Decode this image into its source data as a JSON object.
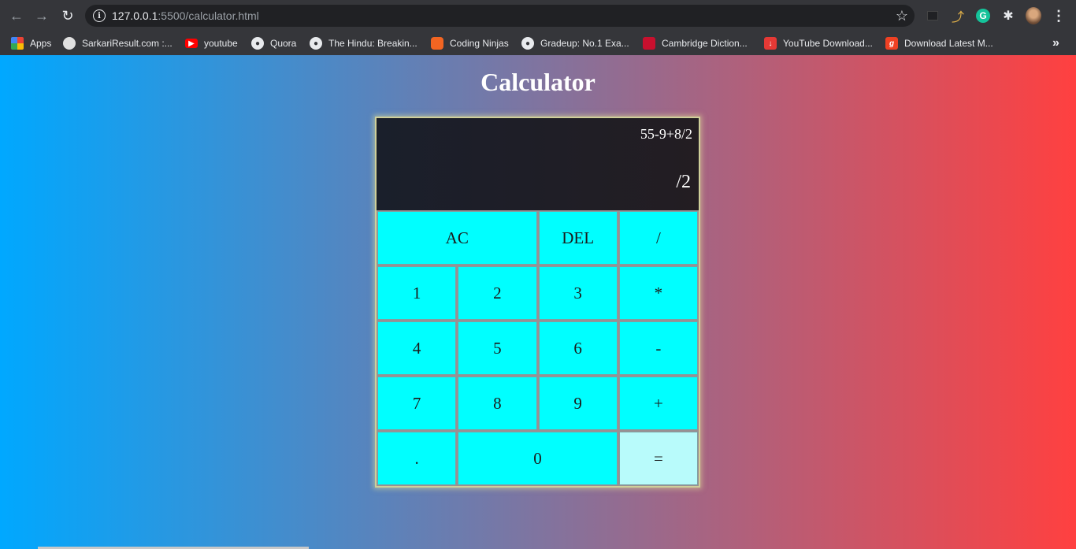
{
  "browser": {
    "url_host": "127.0.0.1",
    "url_rest": ":5500/calculator.html",
    "bookmarks": [
      {
        "label": "Apps",
        "icon": "apps-grid-icon"
      },
      {
        "label": "SarkariResult.com :...",
        "icon": "sarkariresult-icon"
      },
      {
        "label": "youtube",
        "icon": "youtube-icon"
      },
      {
        "label": "Quora",
        "icon": "globe-icon"
      },
      {
        "label": "The Hindu: Breakin...",
        "icon": "globe-icon"
      },
      {
        "label": "Coding Ninjas",
        "icon": "coding-ninjas-icon"
      },
      {
        "label": "Gradeup: No.1 Exa...",
        "icon": "globe-icon"
      },
      {
        "label": "Cambridge Diction...",
        "icon": "cambridge-icon"
      },
      {
        "label": "YouTube Download...",
        "icon": "download-icon"
      },
      {
        "label": "Download Latest M...",
        "icon": "g-icon"
      }
    ]
  },
  "page": {
    "title": "Calculator",
    "background_gradient": [
      "#00a8ff",
      "#ff4040"
    ]
  },
  "calculator": {
    "previous_operand": "55-9+8/2",
    "current_operand": "/2",
    "key_color": "#00ffff",
    "equals_color": "#b8fbfb",
    "keys": [
      {
        "label": "AC",
        "name": "all-clear-button",
        "span": 2
      },
      {
        "label": "DEL",
        "name": "delete-button",
        "span": 1
      },
      {
        "label": "/",
        "name": "divide-button",
        "span": 1
      },
      {
        "label": "1",
        "name": "digit-1-button",
        "span": 1
      },
      {
        "label": "2",
        "name": "digit-2-button",
        "span": 1
      },
      {
        "label": "3",
        "name": "digit-3-button",
        "span": 1
      },
      {
        "label": "*",
        "name": "multiply-button",
        "span": 1
      },
      {
        "label": "4",
        "name": "digit-4-button",
        "span": 1
      },
      {
        "label": "5",
        "name": "digit-5-button",
        "span": 1
      },
      {
        "label": "6",
        "name": "digit-6-button",
        "span": 1
      },
      {
        "label": "-",
        "name": "subtract-button",
        "span": 1
      },
      {
        "label": "7",
        "name": "digit-7-button",
        "span": 1
      },
      {
        "label": "8",
        "name": "digit-8-button",
        "span": 1
      },
      {
        "label": "9",
        "name": "digit-9-button",
        "span": 1
      },
      {
        "label": "+",
        "name": "add-button",
        "span": 1
      },
      {
        "label": ".",
        "name": "decimal-button",
        "span": 1
      },
      {
        "label": "0",
        "name": "digit-0-button",
        "span": 2
      },
      {
        "label": "=",
        "name": "equals-button",
        "span": 1
      }
    ]
  }
}
